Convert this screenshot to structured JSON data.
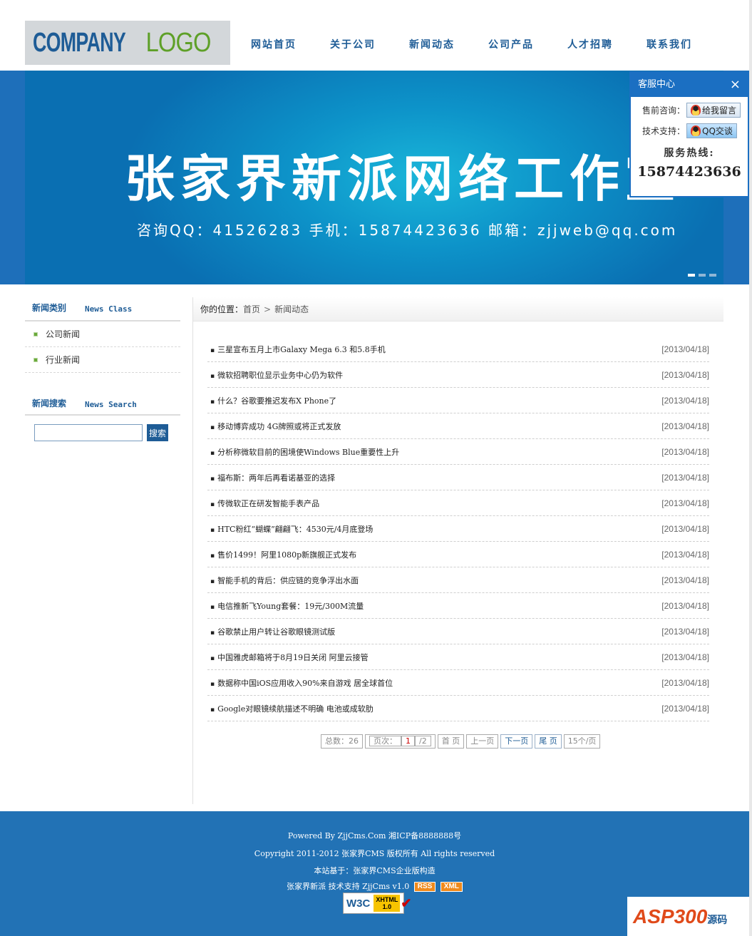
{
  "header": {
    "logo_part1": "COMPANY",
    "logo_part2": "LOGO",
    "nav": [
      "网站首页",
      "关于公司",
      "新闻动态",
      "公司产品",
      "人才招聘",
      "联系我们"
    ]
  },
  "banner": {
    "title": "张家界新派网络工作室",
    "subtitle": "咨询QQ：41526283  手机：15874423636   邮箱：zjjweb@qq.com"
  },
  "kefu": {
    "title": "客服中心",
    "close_icon": "×",
    "presale_label": "售前咨询：",
    "presale_btn": "给我留言",
    "tech_label": "技术支持：",
    "tech_btn": "QQ交谈",
    "hotline_label": "服务热线:",
    "hotline": "15874423636"
  },
  "sidebar": {
    "class_title_cn": "新闻类别",
    "class_title_en": "News Class",
    "classes": [
      "公司新闻",
      "行业新闻"
    ],
    "search_title_cn": "新闻搜索",
    "search_title_en": "News Search",
    "search_btn": "搜索"
  },
  "breadcrumb": {
    "label": "你的位置：",
    "home": "首页",
    "sep": ">",
    "current": "新闻动态"
  },
  "news": [
    {
      "title": "三星宣布五月上市Galaxy Mega 6.3 和5.8手机",
      "date": "[2013/04/18]"
    },
    {
      "title": "微软招聘职位显示业务中心仍为软件",
      "date": "[2013/04/18]"
    },
    {
      "title": "什么？谷歌要推迟发布X Phone了",
      "date": "[2013/04/18]"
    },
    {
      "title": "移动博弈成功 4G牌照或将正式发放",
      "date": "[2013/04/18]"
    },
    {
      "title": "分析称微软目前的困境使Windows Blue重要性上升",
      "date": "[2013/04/18]"
    },
    {
      "title": "福布斯：两年后再看诺基亚的选择",
      "date": "[2013/04/18]"
    },
    {
      "title": "传微软正在研发智能手表产品",
      "date": "[2013/04/18]"
    },
    {
      "title": "HTC粉红“蝴蝶”翩翩飞：4530元/4月底登场",
      "date": "[2013/04/18]"
    },
    {
      "title": "售价1499！阿里1080p新旗舰正式发布",
      "date": "[2013/04/18]"
    },
    {
      "title": "智能手机的背后：供应链的竞争浮出水面",
      "date": "[2013/04/18]"
    },
    {
      "title": "电信推新飞Young套餐：19元/300M流量",
      "date": "[2013/04/18]"
    },
    {
      "title": "谷歌禁止用户转让谷歌眼镜测试版",
      "date": "[2013/04/18]"
    },
    {
      "title": "中国雅虎邮箱将于8月19日关闭 阿里云接管",
      "date": "[2013/04/18]"
    },
    {
      "title": "数据称中国iOS应用收入90%来自游戏 居全球首位",
      "date": "[2013/04/18]"
    },
    {
      "title": "Google对眼镜续航描述不明确 电池或成软肋",
      "date": "[2013/04/18]"
    }
  ],
  "pager": {
    "total": "总数：26",
    "page_prefix": "页次：",
    "page_current": "1",
    "page_suffix": "/2",
    "first": "首  页",
    "prev": "上一页",
    "next": "下一页",
    "last": "尾  页",
    "per_page": "15个/页"
  },
  "footer": {
    "powered": "Powered By ZjjCms.Com 湘ICP备8888888号",
    "copyright": "Copyright 2011-2012 张家界CMS 版权所有 All rights reserved",
    "based_on": "本站基于：张家界CMS企业版构造",
    "support": "张家界新派 技术支持 ZjjCms v1.0",
    "rss": "RSS",
    "xml": "XML",
    "w3c": "W3C",
    "xhtml": "XHTML",
    "xhtml_ver": "1.0"
  },
  "watermark": {
    "main": "ASP300",
    "suffix": "源码"
  },
  "colors": {
    "brand_blue": "#1e5c96",
    "footer_blue": "#2272b5",
    "logo_green": "#5ea028"
  }
}
